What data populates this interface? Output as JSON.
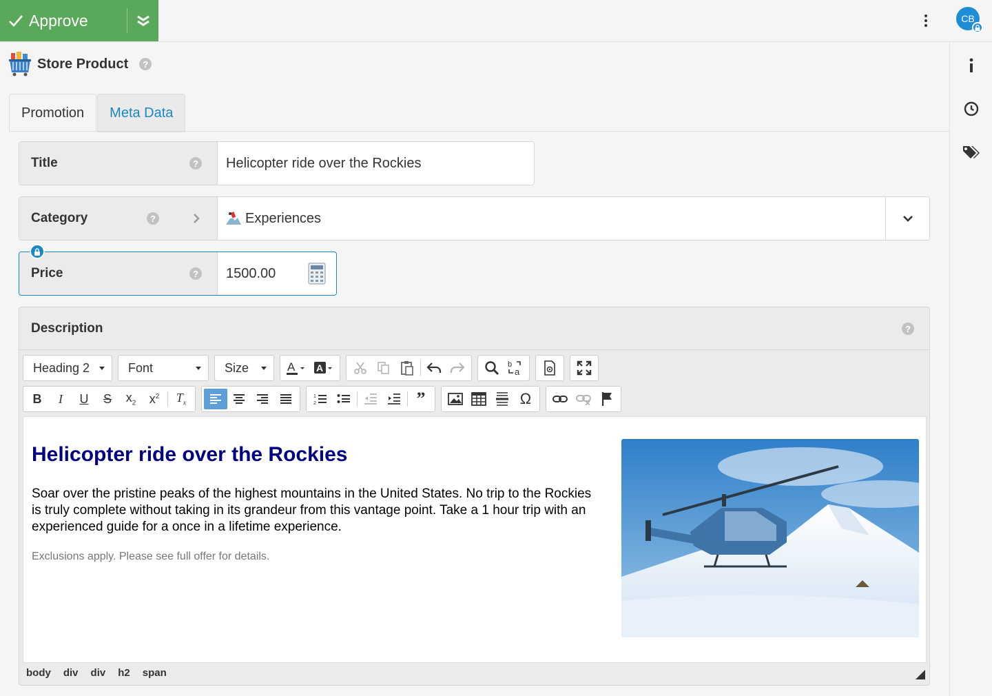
{
  "toolbar": {
    "approve_label": "Approve",
    "avatar_initials": "CB"
  },
  "header": {
    "title": "Store Product"
  },
  "tabs": [
    {
      "label": "Promotion",
      "active": true
    },
    {
      "label": "Meta Data",
      "active": false
    }
  ],
  "fields": {
    "title": {
      "label": "Title",
      "value": "Helicopter ride over the Rockies"
    },
    "category": {
      "label": "Category",
      "value": "Experiences"
    },
    "price": {
      "label": "Price",
      "value": "1500.00"
    }
  },
  "description": {
    "label": "Description",
    "toolbar": {
      "format": "Heading 2",
      "font": "Font",
      "size": "Size"
    },
    "content": {
      "heading": "Helicopter ride over the Rockies",
      "paragraph": "Soar over the pristine peaks of the highest mountains in the United States. No trip to the Rockies is truly complete without taking in its grandeur from this vantage point. Take a 1 hour trip with an experienced guide for a once in a lifetime experience.",
      "note": "Exclusions apply. Please see full offer for details."
    },
    "path": [
      "body",
      "div",
      "div",
      "h2",
      "span"
    ]
  },
  "colors": {
    "approve": "#5aa95a",
    "link": "#1a87c8",
    "heading": "#000080",
    "avatar": "#1f8dd6"
  }
}
